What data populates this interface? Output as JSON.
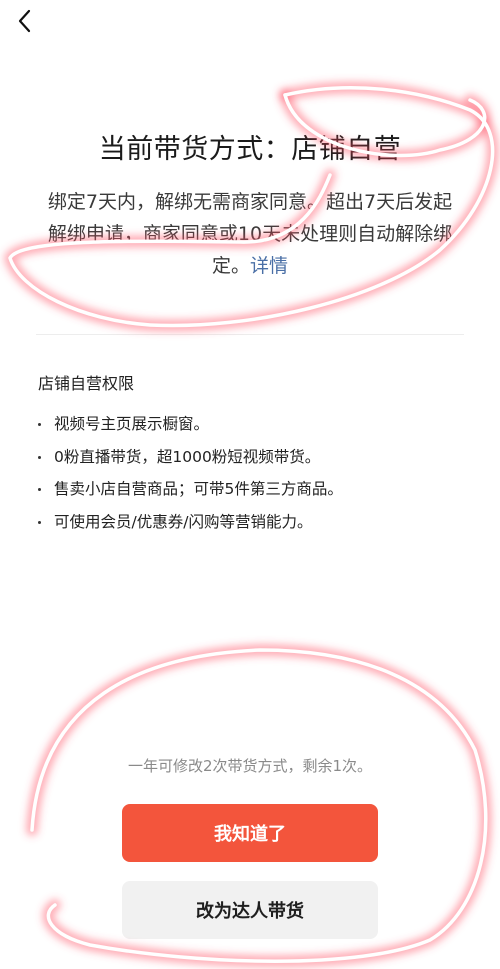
{
  "nav": {
    "back_icon": "chevron-left-icon"
  },
  "header": {
    "title": "当前带货方式：店铺自营"
  },
  "description": {
    "text": "绑定7天内，解绑无需商家同意。超出7天后发起解绑申请，商家同意或10天未处理则自动解除绑定。",
    "link": "详情"
  },
  "rights": {
    "title": "店铺自营权限",
    "items": [
      "视频号主页展示橱窗。",
      "0粉直播带货，超1000粉短视频带货。",
      "售卖小店自营商品；可带5件第三方商品。",
      "可使用会员/优惠券/闪购等营销能力。"
    ]
  },
  "footer": {
    "quota_text": "一年可修改2次带货方式，剩余1次。",
    "confirm_label": "我知道了",
    "switch_label": "改为达人带货"
  },
  "colors": {
    "primary_button": "#f3553c",
    "secondary_button": "#f1f1f1",
    "link": "#4a6fa6",
    "scribble": "#ff5a6a"
  }
}
